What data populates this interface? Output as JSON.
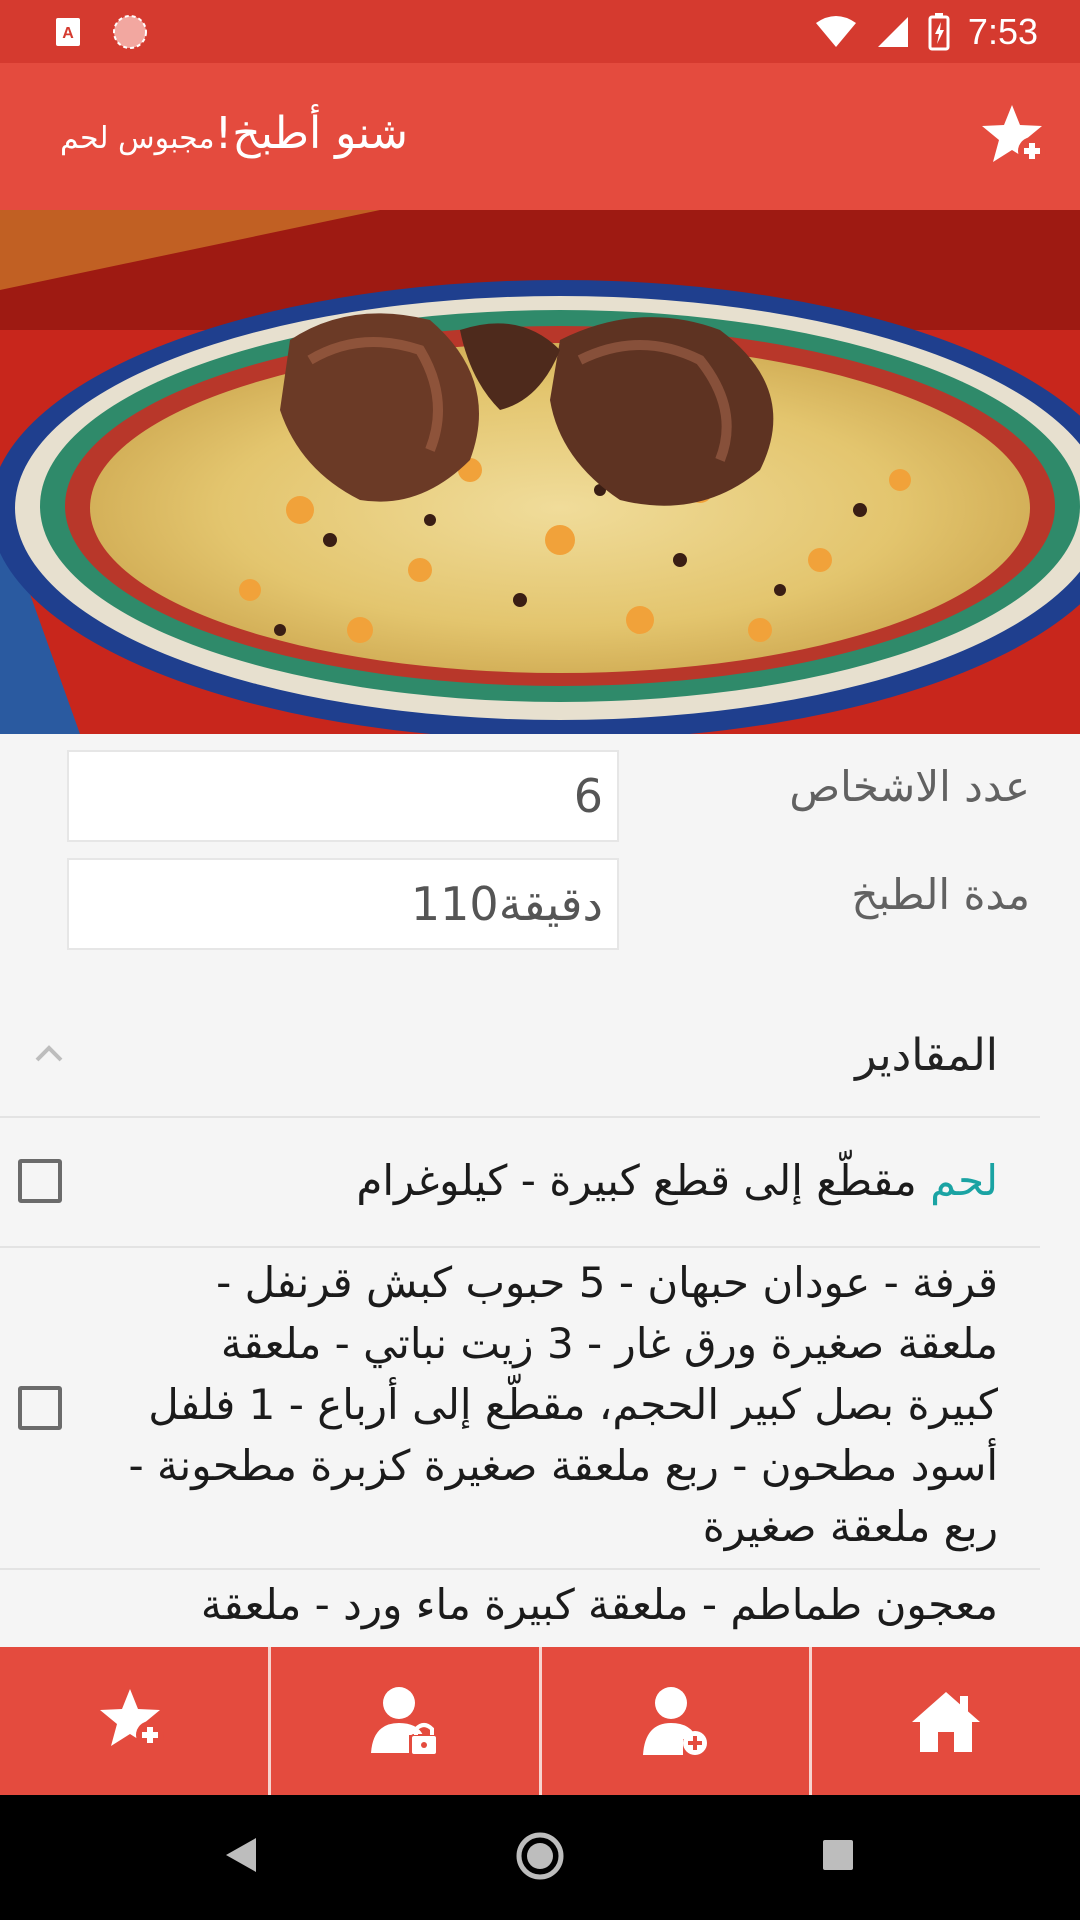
{
  "status_bar": {
    "time": "7:53",
    "icons": [
      "app-a-icon",
      "record-icon",
      "wifi-icon",
      "signal-icon",
      "battery-charging-icon"
    ]
  },
  "app_bar": {
    "title": "شنو أطبخ!",
    "subtitle": "مجبوس لحم",
    "action_icon": "star-add-icon"
  },
  "recipe": {
    "servings_label": "عدد الاشخاص",
    "servings_value": "6",
    "cook_time_label": "مدة الطبخ",
    "cook_time_value": "110دقيقة"
  },
  "ingredients": {
    "section_title": "المقادير",
    "items": [
      {
        "highlight": "لحم",
        "text": "مقطّع إلى قطع كبيرة - كيلوغرام"
      },
      {
        "text": "قرفة - عودان حبهان - 5 حبوب كبش قرنفل - ملعقة صغيرة ورق غار - 3 زيت نباتي - ملعقة كبيرة بصل كبير الحجم، مقطّع إلى أرباع - 1 فلفل أسود مطحون - ربع ملعقة صغيرة كزبرة مطحونة - ربع ملعقة صغيرة"
      },
      {
        "text": "معجون طماطم - ملعقة كبيرة ماء ورد - ملعقة"
      }
    ]
  },
  "bottom_nav": [
    "star-add-icon",
    "user-lock-icon",
    "user-add-icon",
    "home-icon"
  ],
  "system_nav": [
    "back-icon",
    "home-circle-icon",
    "recents-icon"
  ],
  "colors": {
    "primary": "#e44b3e",
    "status": "#d53a2f",
    "accent": "#1aa3a3"
  }
}
